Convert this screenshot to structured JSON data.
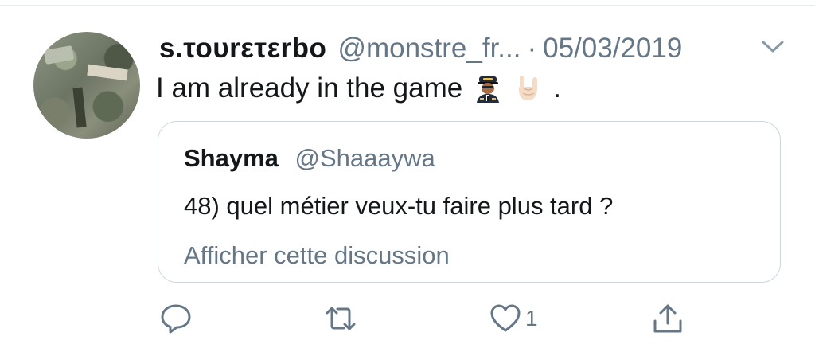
{
  "tweet": {
    "display_name": "s.τουrετεrbo",
    "handle": "@monstre_fr...",
    "separator": "·",
    "date": "05/03/2019",
    "text": "I am already in the game",
    "trailing": ".",
    "emojis": [
      "pilot-emoji",
      "sign-of-horns-emoji"
    ]
  },
  "quote": {
    "name": "Shayma",
    "handle": "@Shaaaywa",
    "text": "48) quel métier veux-tu faire plus tard ?",
    "link": "Afficher cette discussion"
  },
  "actions": {
    "like_count": "1",
    "icons": [
      "reply-icon",
      "retweet-icon",
      "like-icon",
      "share-icon"
    ]
  },
  "colors": {
    "text": "#14171a",
    "secondary": "#657786",
    "border": "#ccd6dd"
  }
}
